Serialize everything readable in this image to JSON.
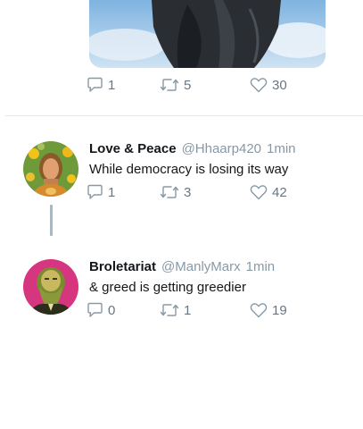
{
  "tweets": [
    {
      "reply_count": "1",
      "retweet_count": "5",
      "like_count": "30"
    },
    {
      "display_name": "Love & Peace",
      "handle": "@Hhaarp420",
      "time": "1min",
      "text": "While democracy is losing its way",
      "reply_count": "1",
      "retweet_count": "3",
      "like_count": "42"
    },
    {
      "display_name": "Broletariat",
      "handle": "@ManlyMarx",
      "time": "1min",
      "text": "& greed is getting greedier",
      "reply_count": "0",
      "retweet_count": "1",
      "like_count": "19"
    }
  ],
  "colors": {
    "icon_gray": "#657786",
    "text_primary": "#14171a",
    "text_secondary": "#8899a6",
    "divider": "#e1e8ed",
    "thread_line": "#aab8c2"
  }
}
